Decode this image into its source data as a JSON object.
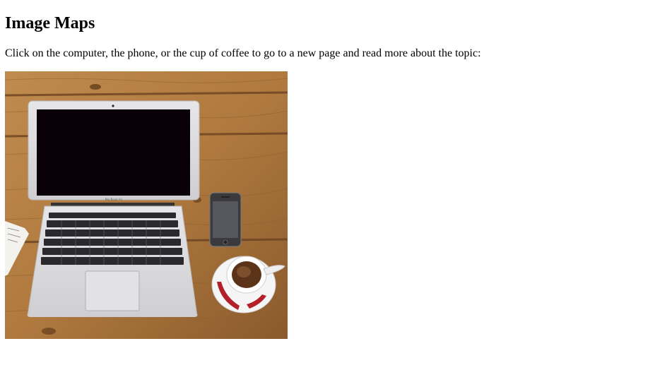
{
  "heading": "Image Maps",
  "intro": "Click on the computer, the phone, or the cup of coffee to go to a new page and read more about the topic:",
  "image": {
    "alt": "Workplace",
    "laptop_brand_text": "MacBook Air",
    "areas": [
      {
        "name": "Computer",
        "shape": "rect"
      },
      {
        "name": "Phone",
        "shape": "rect"
      },
      {
        "name": "Coffee",
        "shape": "circle"
      }
    ]
  },
  "colors": {
    "wood_light": "#b88449",
    "wood_dark": "#7a4f24",
    "laptop_silver": "#d9d9dc",
    "screen": "#0a0008",
    "cup_red": "#b3202a"
  }
}
